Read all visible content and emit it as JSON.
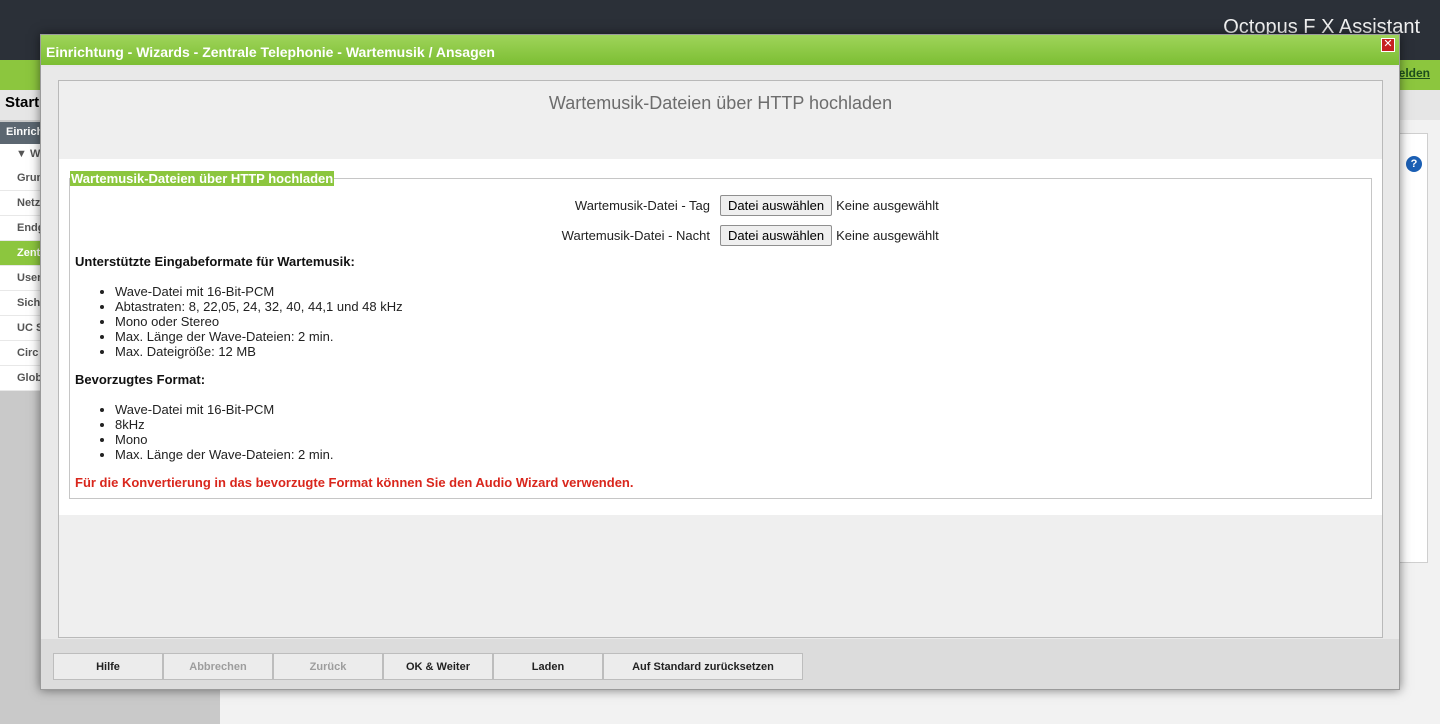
{
  "app": {
    "title": "Octopus F X Assistant",
    "logout": "elden",
    "start": "Start",
    "sidebar": {
      "header": "Einrich",
      "wizard": "Wiza",
      "items": [
        "Grun",
        "Netz",
        "Endg",
        "Zent",
        "User",
        "Sich",
        "UC S",
        "Circ",
        "Glob"
      ]
    },
    "help_label": "?"
  },
  "modal": {
    "title": "Einrichtung - Wizards - Zentrale Telephonie - Wartemusik / Ansagen",
    "close_label": "✕",
    "heading": "Wartemusik-Dateien über HTTP hochladen",
    "fieldset_legend": "Wartemusik-Dateien über HTTP hochladen",
    "files": [
      {
        "label": "Wartemusik-Datei - Tag",
        "button": "Datei auswählen",
        "status": "Keine ausgewählt"
      },
      {
        "label": "Wartemusik-Datei - Nacht",
        "button": "Datei auswählen",
        "status": "Keine ausgewählt"
      }
    ],
    "supported_title": "Unterstützte Eingabeformate für Wartemusik:",
    "supported": [
      "Wave-Datei mit 16-Bit-PCM",
      "Abtastraten: 8, 22,05, 24, 32, 40, 44,1 und 48 kHz",
      "Mono oder Stereo",
      "Max. Länge der Wave-Dateien: 2 min.",
      "Max. Dateigröße: 12 MB"
    ],
    "preferred_title": "Bevorzugtes Format:",
    "preferred": [
      "Wave-Datei mit 16-Bit-PCM",
      "8kHz",
      "Mono",
      "Max. Länge der Wave-Dateien: 2 min."
    ],
    "note": "Für die Konvertierung in das bevorzugte Format können Sie den Audio Wizard verwenden.",
    "footer": {
      "help": "Hilfe",
      "cancel": "Abbrechen",
      "back": "Zurück",
      "ok_next": "OK & Weiter",
      "load": "Laden",
      "reset": "Auf Standard zurücksetzen"
    }
  },
  "colors": {
    "accent_green": "#8cc63e",
    "header_dark": "#2b3038",
    "note_red": "#d9261c"
  }
}
